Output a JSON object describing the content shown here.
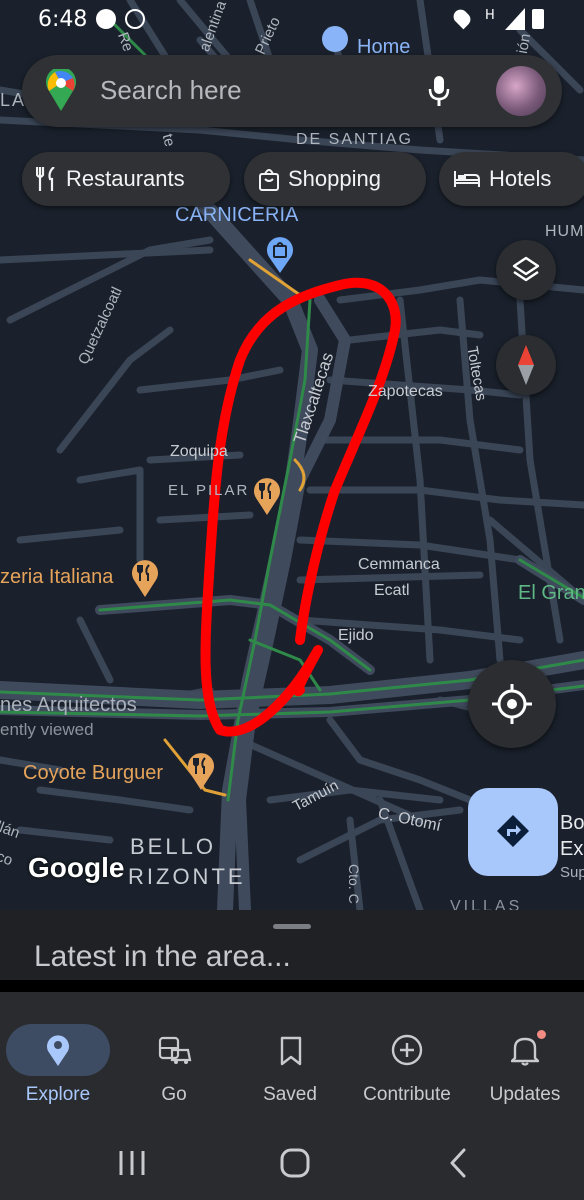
{
  "status_bar": {
    "time": "6:48"
  },
  "search": {
    "placeholder": "Search here"
  },
  "chips": [
    {
      "label": "Restaurants"
    },
    {
      "label": "Shopping"
    },
    {
      "label": "Hotels"
    }
  ],
  "map": {
    "labels": {
      "home": "Home",
      "de_santiago": "DE SANTIAG",
      "carniceria": "CARNICERIA",
      "hum": "HUM",
      "quetzalcoatl": "Quetzalcoatl",
      "tlaxcaltecas": "Tlaxcaltecas",
      "zapotecas": "Zapotecas",
      "toltecas": "Toltecas",
      "zoquipa": "Zoquipa",
      "el_pilar": "EL PILAR",
      "pizzeria": "zeria Italiana",
      "cemmanca": "Cemmanca",
      "ecatl": "Ecatl",
      "el_gran": "El Gran",
      "ejido": "Ejido",
      "arquitectos": "nes Arquitectos",
      "recently_viewed": "ently viewed",
      "coyote_burguer": "Coyote Burguer",
      "tamuin": "Tamuín",
      "c_otomi": "C. Otomí",
      "bello": "BELLO",
      "horizonte": "RIZONTE",
      "villas": "VILLAS",
      "llan": "llán",
      "co": "co",
      "cto_c": "Cto. C",
      "bo": "Bo",
      "ex": "Ex",
      "sup": "Sup",
      "la": "LA",
      "valentina": "alentina",
      "prieto": "Prieto",
      "ren": "Re",
      "te": "te",
      "ion": "ión",
      "c_right": "C"
    },
    "google_logo": "Google",
    "accent_colors": {
      "map_bg": "#1a212c",
      "road": "#3a4556",
      "traffic_green": "#2f8a4a",
      "traffic_orange": "#e0a236",
      "annotation_red": "#ff0000",
      "poi_food": "#e6a35a",
      "poi_shop": "#6ea7f5"
    }
  },
  "bottom_sheet": {
    "title": "Latest in the area..."
  },
  "nav": [
    {
      "label": "Explore",
      "icon": "explore-pin-icon",
      "active": true
    },
    {
      "label": "Go",
      "icon": "commute-icon"
    },
    {
      "label": "Saved",
      "icon": "bookmark-icon"
    },
    {
      "label": "Contribute",
      "icon": "add-circle-icon"
    },
    {
      "label": "Updates",
      "icon": "bell-icon"
    }
  ]
}
